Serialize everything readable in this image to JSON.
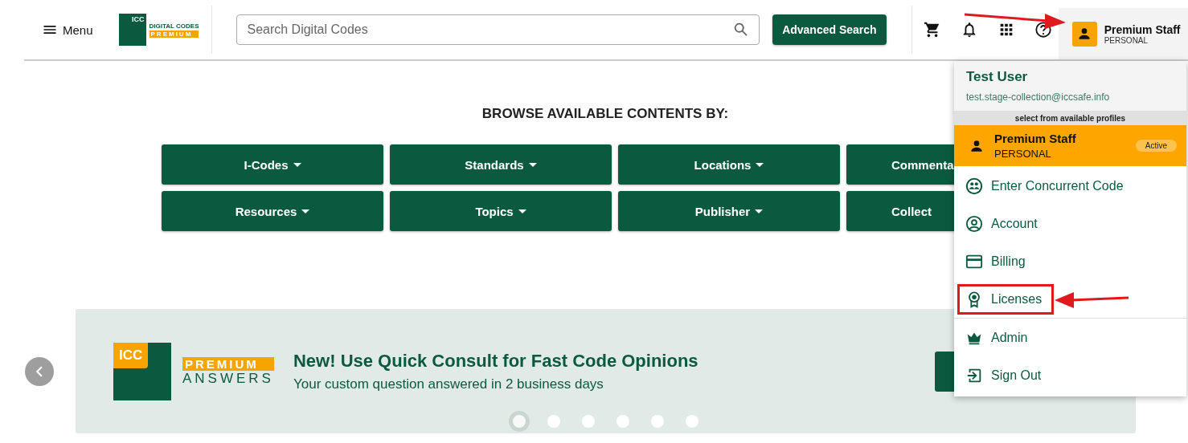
{
  "header": {
    "menu_label": "Menu",
    "logo": {
      "line_1": "ICC",
      "line_2": "DIGITAL CODES",
      "line_3": "PREMIUM"
    },
    "search": {
      "placeholder": "Search Digital Codes"
    },
    "advanced_search": "Advanced Search",
    "user": {
      "name": "Premium Staff",
      "profile": "PERSONAL",
      "expanded": true
    }
  },
  "browse": {
    "title": "BROWSE AVAILABLE CONTENTS BY:",
    "buttons": [
      {
        "label": "I-Codes"
      },
      {
        "label": "Standards"
      },
      {
        "label": "Locations"
      },
      {
        "label": "Commenta"
      },
      {
        "label": "Resources"
      },
      {
        "label": "Topics"
      },
      {
        "label": "Publisher"
      },
      {
        "label": "Collect"
      }
    ]
  },
  "banner": {
    "logo": {
      "line_1": "ICC",
      "line_2": "PREMIUM",
      "line_3": "ANSWERS"
    },
    "title": "New! Use Quick Consult for Fast Code Opinions",
    "subtitle": "Your custom question answered in 2 business days",
    "dots": [
      {
        "selected": true
      },
      {
        "selected": false
      },
      {
        "selected": false
      },
      {
        "selected": false
      },
      {
        "selected": false
      },
      {
        "selected": false
      }
    ]
  },
  "dropdown": {
    "user_name": "Test User",
    "email": "test.stage-collection@iccsafe.info",
    "profiles_label": "select from available profiles",
    "profiles": [
      {
        "name": "Premium Staff",
        "type": "PERSONAL",
        "badge": "Active",
        "selected": true
      }
    ],
    "items": [
      {
        "kind": "concurrent",
        "label": "Enter Concurrent Code",
        "highlighted": false
      },
      {
        "kind": "account",
        "label": "Account",
        "highlighted": false
      },
      {
        "kind": "billing",
        "label": "Billing",
        "highlighted": false
      },
      {
        "kind": "licenses",
        "label": "Licenses",
        "highlighted": true
      },
      {
        "kind": "admin",
        "label": "Admin",
        "highlighted": false
      },
      {
        "kind": "signout",
        "label": "Sign Out",
        "highlighted": false
      }
    ]
  }
}
